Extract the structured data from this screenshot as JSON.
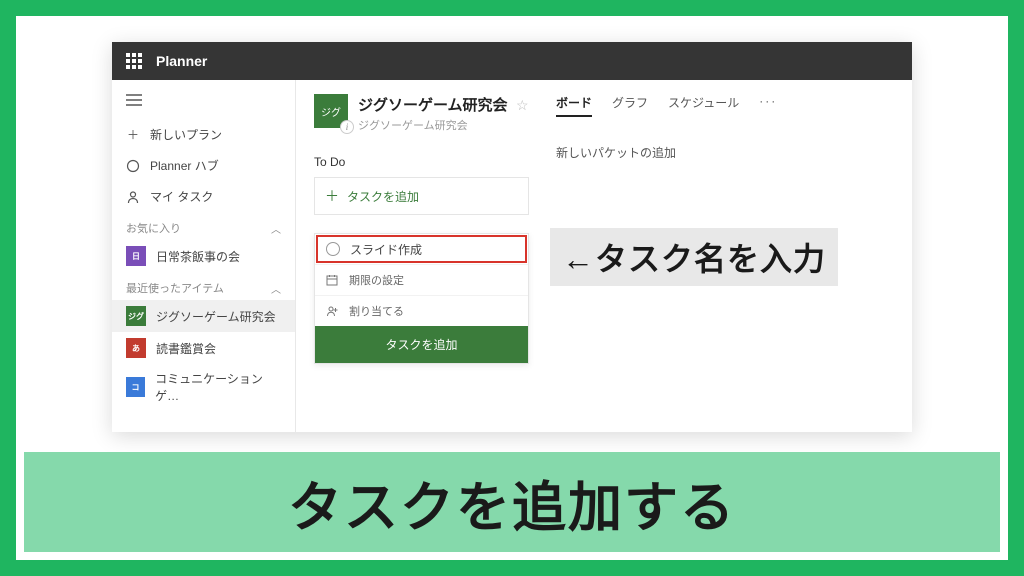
{
  "app_name": "Planner",
  "sidebar": {
    "nav": [
      {
        "label": "新しいプラン",
        "icon": "plus"
      },
      {
        "label": "Planner ハブ",
        "icon": "circle"
      },
      {
        "label": "マイ タスク",
        "icon": "person"
      }
    ],
    "section_favorites": "お気に入り",
    "favorites": [
      {
        "label": "日常茶飯事の会",
        "badge": "日",
        "color": "b-purple"
      }
    ],
    "section_recent": "最近使ったアイテム",
    "recent": [
      {
        "label": "ジグソーゲーム研究会",
        "badge": "ジグ",
        "color": "b-green",
        "active": true
      },
      {
        "label": "読書鑑賞会",
        "badge": "あ",
        "color": "b-red"
      },
      {
        "label": "コミュニケーションゲ…",
        "badge": "コ",
        "color": "b-blue"
      }
    ]
  },
  "plan": {
    "title": "ジグソーゲーム研究会",
    "subtitle": "ジグソーゲーム研究会",
    "avatar": "ジグ"
  },
  "tabs": [
    "ボード",
    "グラフ",
    "スケジュール"
  ],
  "bucket_todo": "To Do",
  "bucket_new": "新しいパケットの追加",
  "add_task_label": "タスクを追加",
  "task_form": {
    "name_value": "スライド作成",
    "due_label": "期限の設定",
    "assign_label": "割り当てる",
    "submit": "タスクを追加"
  },
  "annotation": "←タスク名を入力",
  "caption": "タスクを追加する"
}
